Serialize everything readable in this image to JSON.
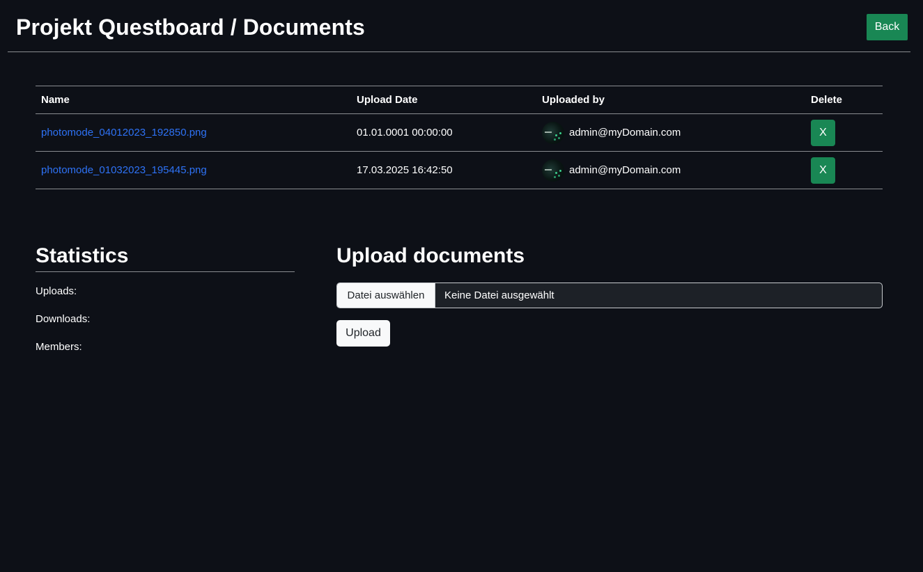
{
  "header": {
    "title": "Projekt Questboard / Documents",
    "back_label": "Back"
  },
  "table": {
    "columns": [
      "Name",
      "Upload Date",
      "Uploaded by",
      "Delete"
    ],
    "rows": [
      {
        "name": "photomode_04012023_192850.png",
        "upload_date": "01.01.0001 00:00:00",
        "uploaded_by": "admin@myDomain.com",
        "delete_label": "X"
      },
      {
        "name": "photomode_01032023_195445.png",
        "upload_date": "17.03.2025 16:42:50",
        "uploaded_by": "admin@myDomain.com",
        "delete_label": "X"
      }
    ]
  },
  "statistics": {
    "title": "Statistics",
    "uploads_label": "Uploads:",
    "downloads_label": "Downloads:",
    "members_label": "Members:"
  },
  "upload": {
    "title": "Upload documents",
    "choose_label": "Datei auswählen",
    "no_file_label": "Keine Datei ausgewählt",
    "upload_label": "Upload"
  },
  "colors": {
    "background": "#0d1017",
    "accent_green": "#198754",
    "link_blue": "#2e72f5"
  },
  "icons": {
    "avatar": "user-avatar-image"
  }
}
